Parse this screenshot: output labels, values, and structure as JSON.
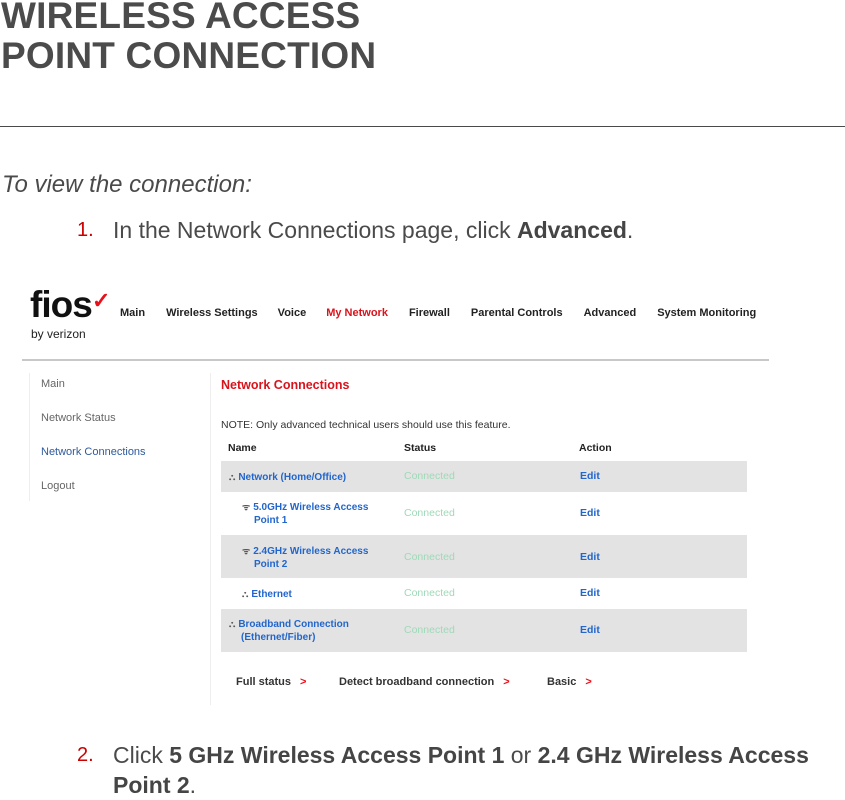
{
  "document": {
    "title_line1": "WIRELESS ACCESS",
    "title_line2": "POINT CONNECTION",
    "intro": "To view the connection:",
    "step1": {
      "num": "1.",
      "text_before": "In the Network Connections page, click ",
      "bold": "Advanced",
      "text_after": "."
    },
    "step2": {
      "num": "2.",
      "text_before": "Click ",
      "bold1": "5 GHz Wireless Access Point 1",
      "mid": " or ",
      "bold2": "2.4 GHz Wireless Access Point 2",
      "text_after": "."
    }
  },
  "router_ui": {
    "logo": {
      "brand": "fios",
      "check": "✓",
      "tagline": "by verizon"
    },
    "topnav": [
      "Main",
      "Wireless Settings",
      "Voice",
      "My Network",
      "Firewall",
      "Parental Controls",
      "Advanced",
      "System Monitoring"
    ],
    "topnav_active": "My Network",
    "sidebar": [
      "Main",
      "Network Status",
      "Network Connections",
      "Logout"
    ],
    "sidebar_active": "Network Connections",
    "page_title": "Network Connections",
    "note": "NOTE: Only advanced technical users should use this feature.",
    "columns": [
      "Name",
      "Status",
      "Action"
    ],
    "rows": [
      {
        "icon": "network-icon",
        "glyph": "⛬",
        "name_line1": "Network (Home/Office)",
        "name_line2": "",
        "status": "Connected",
        "action": "Edit"
      },
      {
        "icon": "wifi-icon",
        "glyph": "ᯤ",
        "name_line1": "5.0GHz Wireless Access",
        "name_line2": "Point 1",
        "status": "Connected",
        "action": "Edit"
      },
      {
        "icon": "wifi-icon",
        "glyph": "ᯤ",
        "name_line1": "2.4GHz Wireless Access",
        "name_line2": "Point 2",
        "status": "Connected",
        "action": "Edit"
      },
      {
        "icon": "network-icon",
        "glyph": "⛬",
        "name_line1": "Ethernet",
        "name_line2": "",
        "status": "Connected",
        "action": "Edit"
      },
      {
        "icon": "network-icon",
        "glyph": "⛬",
        "name_line1": "Broadband Connection",
        "name_line2": "(Ethernet/Fiber)",
        "status": "Connected",
        "action": "Edit"
      }
    ],
    "bottom_links": [
      "Full status",
      "Detect broadband connection",
      "Basic"
    ],
    "chevron": ">"
  },
  "colors": {
    "accent_red": "#d9131c",
    "link_blue": "#2266cc",
    "status_green": "#9fd9b8",
    "row_shade": "#e3e3e3"
  }
}
